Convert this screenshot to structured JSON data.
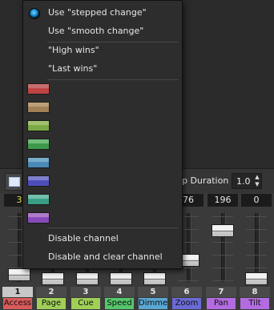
{
  "toolbar": {
    "step_duration_label": "Step Duration",
    "step_duration_value": "1.0"
  },
  "channels": [
    {
      "number": "1",
      "name": "Access",
      "value": "3",
      "color": "#d95b5b",
      "level": 0.06,
      "selected": true
    },
    {
      "number": "2",
      "name": "Page",
      "value": "",
      "color": "#9fcf56",
      "level": 0.0,
      "selected": false
    },
    {
      "number": "3",
      "name": "Cue",
      "value": "",
      "color": "#9fcf56",
      "level": 0.0,
      "selected": false
    },
    {
      "number": "4",
      "name": "Speed",
      "value": "",
      "color": "#55c76b",
      "level": 0.0,
      "selected": false
    },
    {
      "number": "5",
      "name": "Dimmer",
      "value": "",
      "color": "#5aa7d4",
      "level": 0.0,
      "selected": false
    },
    {
      "number": "6",
      "name": "Zoom",
      "value": "76",
      "color": "#6a6ad6",
      "level": 0.3,
      "selected": false
    },
    {
      "number": "7",
      "name": "Pan",
      "value": "196",
      "color": "#b26be0",
      "level": 0.77,
      "selected": false
    },
    {
      "number": "8",
      "name": "Tilt",
      "value": "0",
      "color": "#b26be0",
      "level": 0.0,
      "selected": false
    }
  ],
  "menu": {
    "items": [
      {
        "label": "Use \"stepped change\"",
        "checked": true
      },
      {
        "label": "Use \"smooth change\"",
        "checked": false
      },
      {
        "label": "\"High wins\"",
        "checked": false
      },
      {
        "label": "\"Last wins\"",
        "checked": false
      }
    ],
    "color_swatches": [
      {
        "top": "#e07a7a",
        "bottom": "#c64545"
      },
      {
        "top": "#d4b486",
        "bottom": "#a8845a"
      },
      {
        "top": "#b6dd7a",
        "bottom": "#7fb04a"
      },
      {
        "top": "#7fd68a",
        "bottom": "#3f9e4e"
      },
      {
        "top": "#87c3e6",
        "bottom": "#4b8fbf"
      },
      {
        "top": "#8e8ee8",
        "bottom": "#4f4fc2"
      },
      {
        "top": "#7fd9c2",
        "bottom": "#3aa48a"
      },
      {
        "top": "#c78be8",
        "bottom": "#8c4cc2"
      }
    ],
    "disable_channel": "Disable channel",
    "disable_and_clear": "Disable and clear channel"
  }
}
